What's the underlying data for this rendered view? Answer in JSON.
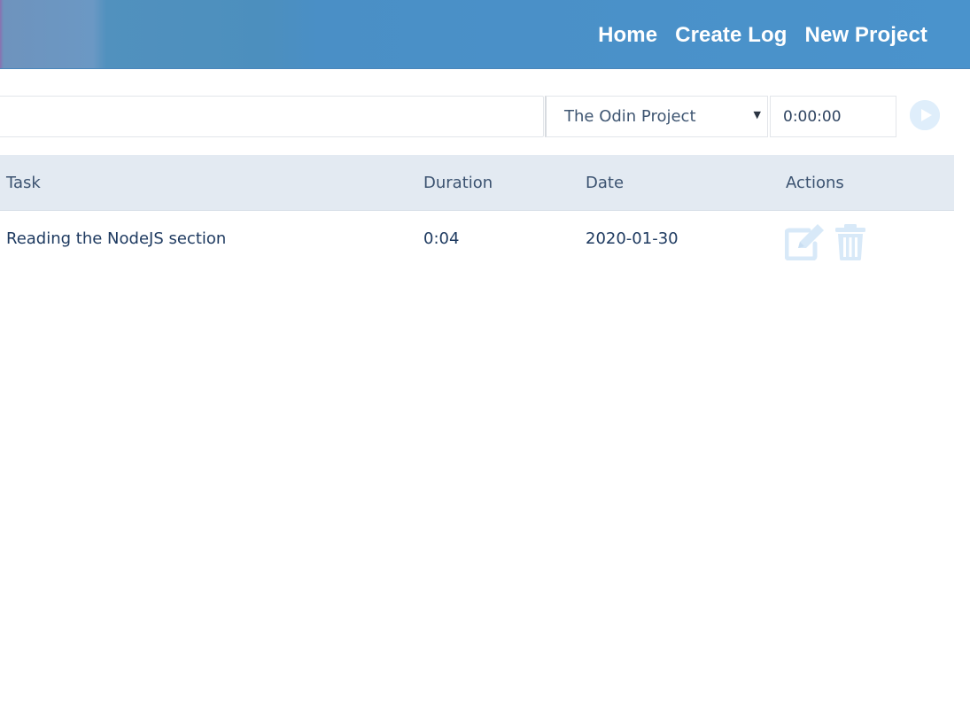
{
  "nav": {
    "links": [
      "Home",
      "Create Log",
      "New Project"
    ]
  },
  "form": {
    "task_value": "",
    "project_selected": "The Odin Project",
    "duration_value": "0:00:00",
    "play_icon": "play-circle-icon"
  },
  "table": {
    "headers": [
      "Task",
      "Duration",
      "Date",
      "Actions"
    ],
    "rows": [
      {
        "task": "Reading the NodeJS section",
        "duration": "0:04",
        "date": "2020-01-30",
        "actions": [
          "edit-icon",
          "trash-icon"
        ]
      }
    ]
  },
  "colors": {
    "navbar": "#4a93cc",
    "header_bg": "#e3eaf2",
    "text": "#1e3a60",
    "icon_faded": "#d8e9f8"
  }
}
